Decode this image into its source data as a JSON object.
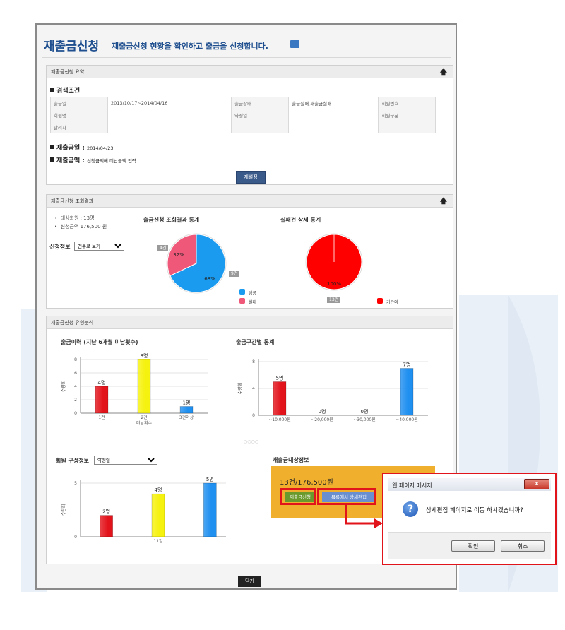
{
  "header": {
    "title": "재출금신청",
    "subtitle": "재출금신청 현황을 확인하고 출금을 신청합니다.",
    "info_icon": "i"
  },
  "summary_panel": {
    "title": "재출금신청 요약",
    "collapse_icon": "up-arrow-icon",
    "search_section": "검색조건",
    "conditions": [
      [
        {
          "k": "출금일",
          "v": "2013/10/17~2014/04/16"
        },
        {
          "k": "출금상태",
          "v": "출금실패,재출금실패"
        },
        {
          "k": "회원번호",
          "v": ""
        }
      ],
      [
        {
          "k": "회원명",
          "v": ""
        },
        {
          "k": "약정일",
          "v": ""
        },
        {
          "k": "회원구분",
          "v": ""
        }
      ],
      [
        {
          "k": "관리자",
          "v": ""
        },
        {
          "k": "",
          "v": ""
        },
        {
          "k": "",
          "v": ""
        }
      ]
    ],
    "rewithdraw_date_label": "재출금일 :",
    "rewithdraw_date_value": "2014/04/23",
    "rewithdraw_amount_label": "재출금액 :",
    "rewithdraw_amount_value": "신청금액에 미납금액 입력",
    "reset_button": "재설정"
  },
  "result_panel": {
    "title": "재출금신청 조회결과",
    "collapse_icon": "up-arrow-icon",
    "bullets": [
      "대상회원 : 13명",
      "신청금액 176,500 원"
    ],
    "filter_label": "신청정보",
    "filter_select": "건수로 보기",
    "pie1": {
      "title": "출금신청 조회결과 통계",
      "tag_fail": "4건",
      "tag_success": "9건",
      "legend": [
        "성공",
        "실패"
      ]
    },
    "pie2": {
      "title": "실패건 상세 통계",
      "tag_total": "13건",
      "legend": [
        "기간외"
      ]
    }
  },
  "analysis_panel": {
    "title": "재출금신청 유형분석",
    "chart1_select": "약정일",
    "member_label": "회원 구성정보",
    "target_title": "재출금대상정보",
    "target_amount": "13건/176,500원",
    "apply_button": "재출금신청",
    "edit_button": "목록에서 상세편집",
    "divider_dots": "○○○○"
  },
  "chart_data": [
    {
      "type": "bar",
      "title": "출금이력 (지난 6개월 미납횟수)",
      "categories": [
        "1건",
        "2건",
        "3건이상"
      ],
      "values": [
        4,
        8,
        1
      ],
      "data_labels": [
        "4명",
        "8명",
        "1명"
      ],
      "ylabel": "수량회",
      "xlabel": "미납횟수",
      "yticks": [
        "0",
        "2",
        "4",
        "6",
        "8"
      ],
      "ylim": [
        0,
        8
      ],
      "colors": [
        "#e3131b",
        "#f6f20f",
        "#1f8ff0"
      ]
    },
    {
      "type": "bar",
      "title": "출금구간별 통계",
      "categories": [
        "~10,000원",
        "~20,000원",
        "~30,000원",
        "~40,000원"
      ],
      "values": [
        5,
        0,
        0,
        7
      ],
      "data_labels": [
        "5명",
        "0명",
        "0명",
        "7명"
      ],
      "ylabel": "수량회",
      "yticks": [
        "0",
        "4",
        "8"
      ],
      "ylim": [
        0,
        8
      ],
      "colors": [
        "#e3131b",
        "#e3131b",
        "#1f8ff0",
        "#1f8ff0"
      ]
    },
    {
      "type": "bar",
      "title": "회원 구성정보",
      "categories": [
        "",
        "11일",
        ""
      ],
      "values": [
        2,
        4,
        5
      ],
      "data_labels": [
        "2명",
        "4명",
        "5명"
      ],
      "ylabel": "수량회",
      "yticks": [
        "0",
        "5"
      ],
      "ylim": [
        0,
        5
      ],
      "colors": [
        "#e3131b",
        "#f6f20f",
        "#1f8ff0"
      ]
    },
    {
      "type": "pie",
      "title": "출금신청 조회결과 통계",
      "labels": [
        "성공",
        "실패"
      ],
      "values": [
        68,
        32
      ],
      "data_labels": [
        "68%",
        "32%"
      ],
      "colors": [
        "#1a9bf0",
        "#f0587a"
      ]
    },
    {
      "type": "pie",
      "title": "실패건 상세 통계",
      "labels": [
        "기간외"
      ],
      "values": [
        100
      ],
      "data_labels": [
        "100%"
      ],
      "colors": [
        "#ff0000"
      ]
    }
  ],
  "dialog": {
    "title": "웹 페이지 메시지",
    "message": "상세편집 페이지로 이동 하시겠습니까?",
    "ok": "확인",
    "cancel": "취소",
    "close": "x",
    "question_icon": "?"
  },
  "footer": {
    "close_button": "닫기"
  },
  "colors": {
    "title_blue": "#1f4f8f",
    "highlight_red": "#e0141a",
    "target_orange": "#f0b02e"
  }
}
